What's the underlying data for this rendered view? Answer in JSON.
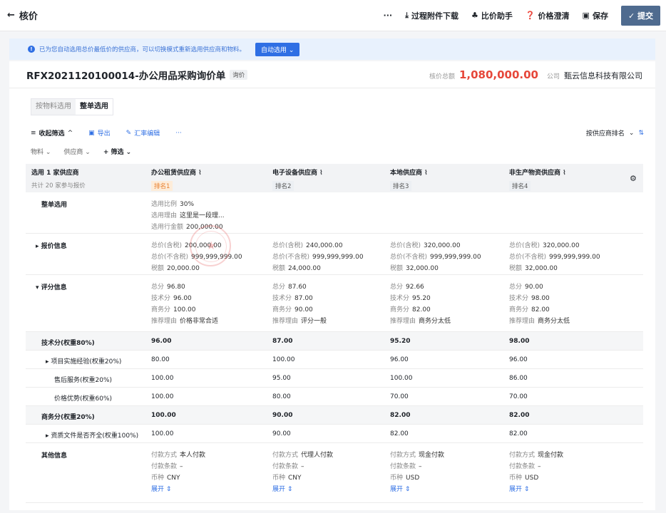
{
  "topbar": {
    "back": "核价",
    "more": "···",
    "download": "过程附件下载",
    "compare": "比价助手",
    "clarify": "价格澄清",
    "save": "保存",
    "submit": "提交"
  },
  "notice": {
    "text": "已为您自动选用总价最低价的供应商，可以切换模式重新选用供应商和物料。",
    "button": "自动选用"
  },
  "header": {
    "title": "RFX2021120100014-办公用品采购询价单",
    "tag": "询价",
    "total_label": "核价总额",
    "total": "1,080,000.00",
    "company_label": "公司",
    "company": "甄云信息科技有限公司"
  },
  "tabs": {
    "by_item": "按物料选用",
    "by_order": "整单选用"
  },
  "toolbar": {
    "collapse": "收起筛选",
    "export": "导出",
    "rate": "汇率编辑",
    "more": "···",
    "sort": "按供应商排名"
  },
  "filters": {
    "item": "物料",
    "supplier": "供应商",
    "add": "筛选"
  },
  "table": {
    "corner_title": "选用 1 家供应商",
    "corner_sub": "共计 20 家参与报价",
    "suppliers": [
      {
        "name": "办公租赁供应商",
        "rank": "排名1"
      },
      {
        "name": "电子设备供应商",
        "rank": "排名2"
      },
      {
        "name": "本地供应商",
        "rank": "排名3"
      },
      {
        "name": "非生产物资供应商",
        "rank": "排名4"
      }
    ],
    "whole": {
      "label": "整单选用",
      "ratio_k": "选用比例",
      "ratio": "30%",
      "reason_k": "选用理由",
      "reason": "这里是一段理...",
      "amount_k": "选用行金额",
      "amount": "200,000.00"
    },
    "quote": {
      "label": "报价信息",
      "k1": "总价(含税)",
      "k2": "总价(不含税)",
      "k3": "税额",
      "rows": [
        [
          "200,000.00",
          "999,999,999.00",
          "20,000.00"
        ],
        [
          "240,000.00",
          "999,999,999.00",
          "24,000.00"
        ],
        [
          "320,000.00",
          "999,999,999.00",
          "32,000.00"
        ],
        [
          "320,000.00",
          "999,999,999.00",
          "32,000.00"
        ]
      ]
    },
    "score": {
      "label": "评分信息",
      "k1": "总分",
      "k2": "技术分",
      "k3": "商务分",
      "k4": "推荐理由",
      "rows": [
        [
          "96.80",
          "96.00",
          "100.00",
          "价格非常合适"
        ],
        [
          "87.60",
          "87.00",
          "90.00",
          "评分一般"
        ],
        [
          "92.66",
          "95.20",
          "82.00",
          "商务分太低"
        ],
        [
          "90.00",
          "98.00",
          "82.00",
          "商务分太低"
        ]
      ]
    },
    "sub": [
      {
        "label": "技术分(权重80%)",
        "vals": [
          "96.00",
          "87.00",
          "95.20",
          "98.00"
        ]
      },
      {
        "label": "项目实施经验(权重20%)",
        "vals": [
          "80.00",
          "100.00",
          "96.00",
          "96.00"
        ]
      },
      {
        "label": "售后服务(权重20%)",
        "vals": [
          "100.00",
          "95.00",
          "100.00",
          "86.00"
        ]
      },
      {
        "label": "价格优势(权重60%)",
        "vals": [
          "100.00",
          "80.00",
          "70.00",
          "70.00"
        ]
      },
      {
        "label": "商务分(权重20%)",
        "vals": [
          "100.00",
          "90.00",
          "82.00",
          "82.00"
        ]
      },
      {
        "label": "资质文件是否齐全(权重100%)",
        "vals": [
          "100.00",
          "90.00",
          "82.00",
          "82.00"
        ]
      }
    ],
    "other": {
      "label": "其他信息",
      "k1": "付款方式",
      "k2": "付款条款",
      "k3": "币种",
      "expand": "展开",
      "rows": [
        [
          "本人付款",
          "–",
          "CNY"
        ],
        [
          "代理人付款",
          "–",
          "CNY"
        ],
        [
          "现金付款",
          "–",
          "USD"
        ],
        [
          "现金付款",
          "–",
          "USD"
        ]
      ]
    }
  }
}
